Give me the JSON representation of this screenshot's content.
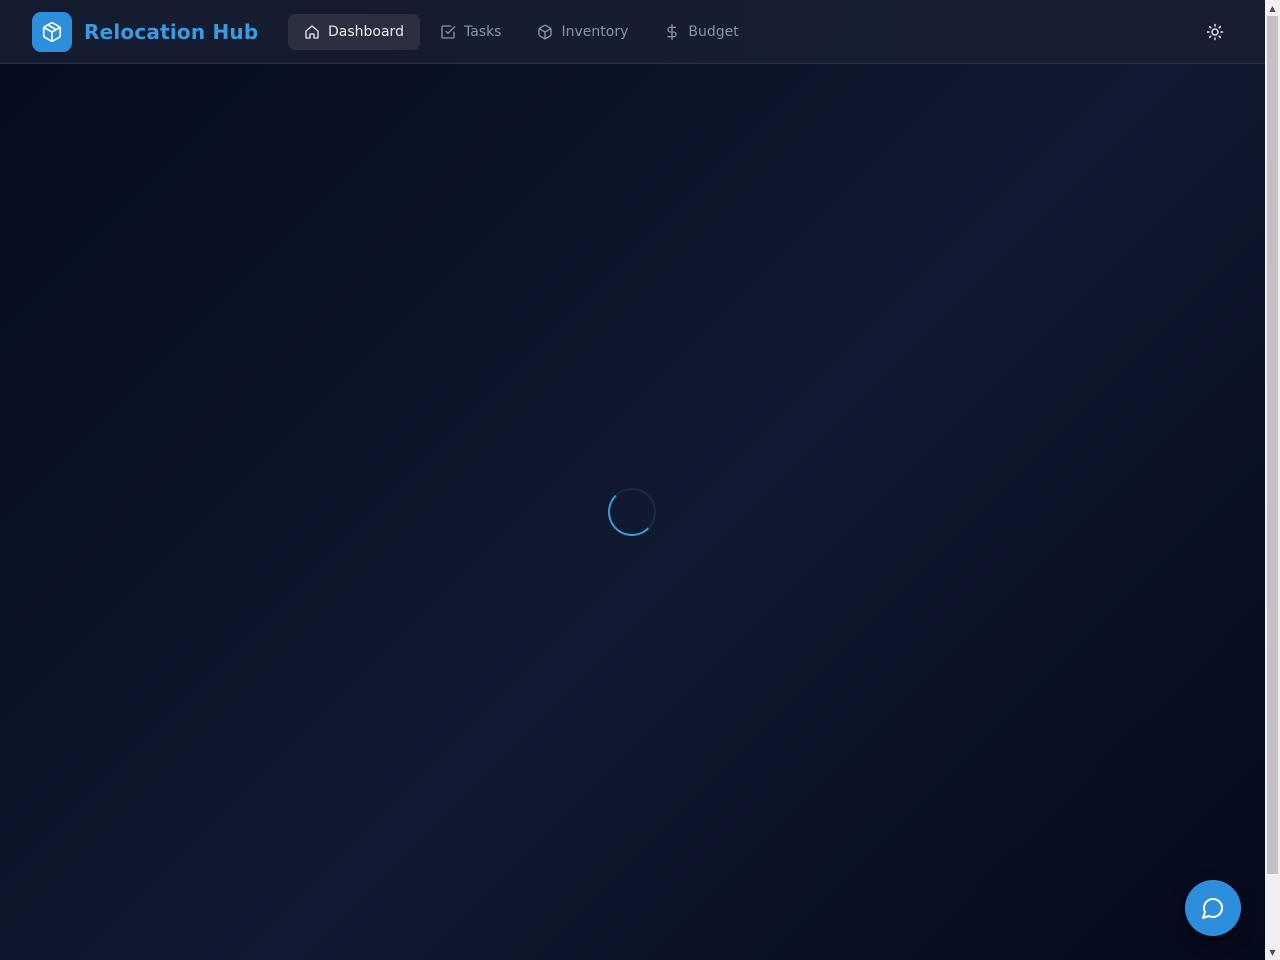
{
  "header": {
    "brand_name": "Relocation Hub",
    "brand_icon": "box-icon",
    "nav": [
      {
        "label": "Dashboard",
        "icon": "home-icon",
        "active": true
      },
      {
        "label": "Tasks",
        "icon": "checkbox-icon",
        "active": false
      },
      {
        "label": "Inventory",
        "icon": "box-icon",
        "active": false
      },
      {
        "label": "Budget",
        "icon": "dollar-icon",
        "active": false
      }
    ],
    "theme_toggle_icon": "sun-icon"
  },
  "main": {
    "loading_indicator": "spinner"
  },
  "chat": {
    "icon": "chat-bubble-icon"
  },
  "colors": {
    "accent": "#2d8fdc",
    "brand_text": "#3a9be0",
    "background": "#0c1428",
    "nav_active_bg": "#2a3040"
  }
}
